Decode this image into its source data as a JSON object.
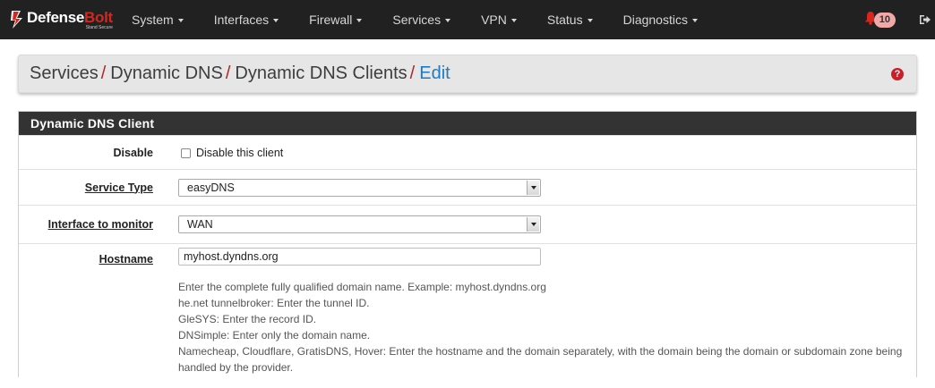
{
  "brand": {
    "name_white": "Defense",
    "name_red": "Bolt",
    "tagline": "Stand Secure"
  },
  "nav": {
    "menu": [
      {
        "label": "System"
      },
      {
        "label": "Interfaces"
      },
      {
        "label": "Firewall"
      },
      {
        "label": "Services"
      },
      {
        "label": "VPN"
      },
      {
        "label": "Status"
      },
      {
        "label": "Diagnostics"
      }
    ],
    "notifications_count": "10"
  },
  "breadcrumb": {
    "items": [
      "Services",
      "Dynamic DNS",
      "Dynamic DNS Clients"
    ],
    "separator": "/",
    "active": "Edit",
    "help_icon": "?"
  },
  "panel": {
    "title": "Dynamic DNS Client",
    "disable": {
      "label": "Disable",
      "checkbox_label": "Disable this client",
      "checked": false
    },
    "service_type": {
      "label": "Service Type",
      "value": "easyDNS"
    },
    "interface": {
      "label": "Interface to monitor",
      "value": "WAN"
    },
    "hostname": {
      "label": "Hostname",
      "value": "myhost.dyndns.org",
      "help": [
        "Enter the complete fully qualified domain name. Example: myhost.dyndns.org",
        "he.net tunnelbroker: Enter the tunnel ID.",
        "GleSYS: Enter the record ID.",
        "DNSimple: Enter only the domain name.",
        "Namecheap, Cloudflare, GratisDNS, Hover: Enter the hostname and the domain separately, with the domain being the domain or subdomain zone being handled by the provider."
      ]
    }
  },
  "colors": {
    "navbar": "#212121",
    "brand_red": "#d9261c",
    "link_blue": "#1f7bc1",
    "panel_heading": "#333333"
  }
}
